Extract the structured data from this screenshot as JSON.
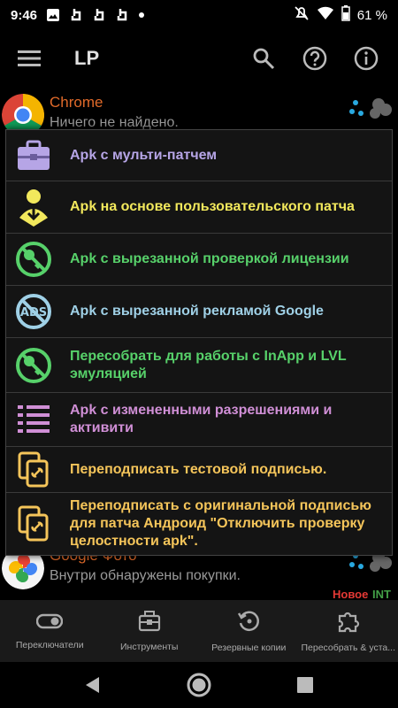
{
  "status_bar": {
    "time": "9:46",
    "battery": "61 %"
  },
  "toolbar": {
    "title": "LP"
  },
  "background_list": {
    "rows": [
      {
        "name": "Chrome",
        "subtitle": "Ничего не найдено.",
        "name_color": "#e06a2a"
      },
      {
        "name": "Google Фото",
        "subtitle": "Внутри обнаружены покупки.",
        "name_color": "#e06a2a"
      }
    ],
    "tags": {
      "new": "Новое",
      "int": "INT"
    }
  },
  "dialog": {
    "options": [
      {
        "label": "Apk с мульти-патчем",
        "color": "#b6a5e6",
        "icon": "briefcase-icon"
      },
      {
        "label": "Apk на основе пользовательского патча",
        "color": "#f2e85c",
        "icon": "user-download-icon"
      },
      {
        "label": "Apk с вырезанной проверкой лицензии",
        "color": "#57d16a",
        "icon": "no-license-icon"
      },
      {
        "label": "Apk с вырезанной рекламой Google",
        "color": "#9fd0e6",
        "icon": "no-ads-icon"
      },
      {
        "label": "Пересобрать для работы с InApp и LVL эмуляцией",
        "color": "#57d16a",
        "icon": "no-license-icon"
      },
      {
        "label": "Apk с измененными разрешениями и активити",
        "color": "#d08fd6",
        "icon": "permissions-list-icon"
      },
      {
        "label": "Переподписать тестовой подписью.",
        "color": "#f5c55a",
        "icon": "copy-link-icon"
      },
      {
        "label": "Переподписать с оригинальной подписью для патча Андроид \"Отключить проверку целостности apk\".",
        "color": "#f5c55a",
        "icon": "copy-link-icon"
      }
    ]
  },
  "bottom_nav": {
    "items": [
      {
        "label": "Переключатели",
        "icon": "toggle-icon"
      },
      {
        "label": "Инструменты",
        "icon": "toolbox-icon"
      },
      {
        "label": "Резервные копии",
        "icon": "backup-icon"
      },
      {
        "label": "Пересобрать & уста...",
        "icon": "puzzle-icon"
      }
    ]
  },
  "colors": {
    "accent_orange": "#e06a2a",
    "tag_new": "#e53935",
    "tag_int": "#43a047"
  }
}
